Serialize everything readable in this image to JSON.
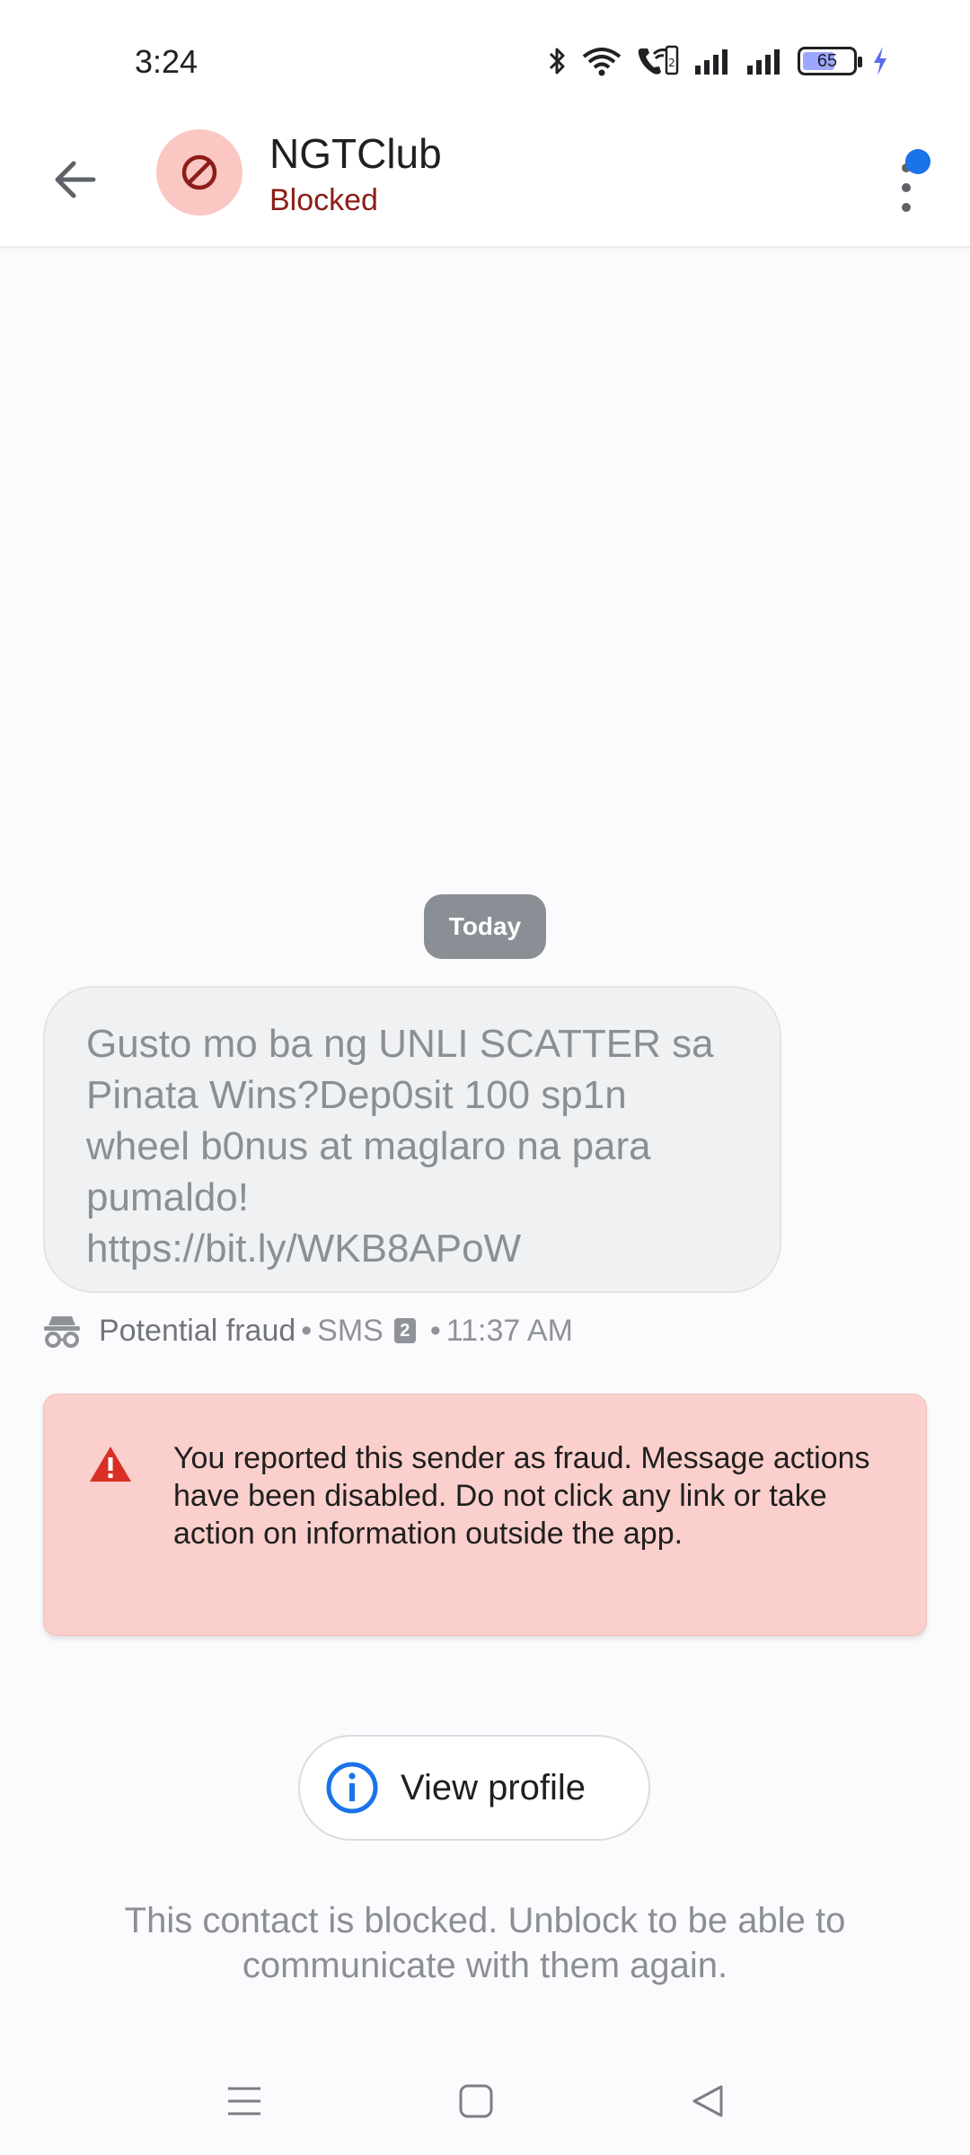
{
  "status_bar": {
    "time": "3:24",
    "battery_level": "65",
    "battery_fraction": 0.65,
    "icons": [
      "bluetooth-icon",
      "wifi-icon",
      "wifi-calling-icon",
      "signal-icon",
      "signal-icon",
      "battery-icon",
      "charging-icon"
    ]
  },
  "header": {
    "title": "NGTClub",
    "subtitle": "Blocked",
    "back_icon": "arrow-left-icon",
    "avatar_icon": "blocked-icon",
    "menu_icon": "more-vert-icon"
  },
  "conversation": {
    "date_label": "Today",
    "message": {
      "text": "Gusto mo ba ng UNLI SCATTER sa Pinata Wins?Dep0sit 100 sp1n wheel b0nus at maglaro na para pumaldo!\nhttps://bit.ly/WKB8APoW",
      "label": "Potential fraud",
      "channel": "SMS",
      "sim": "2",
      "time": "11:37 AM",
      "label_icon": "spy-icon"
    },
    "separator": "•"
  },
  "warning": {
    "icon": "warning-icon",
    "text": "You reported this sender as fraud. Message actions have been disabled. Do not click any link or take action on information outside the app."
  },
  "profile_button": {
    "label": "View profile",
    "icon": "info-icon"
  },
  "blocked_notice": "This contact is blocked. Unblock to be able to communicate with them again.",
  "nav": {
    "icons": [
      "menu-icon",
      "home-icon",
      "back-icon"
    ]
  },
  "colors": {
    "accent": "#1a73e8",
    "blocked_red": "#8c1d18",
    "avatar_bg": "#fac7c3",
    "warning_bg": "#facfcc",
    "warning_icon": "#d93025"
  }
}
